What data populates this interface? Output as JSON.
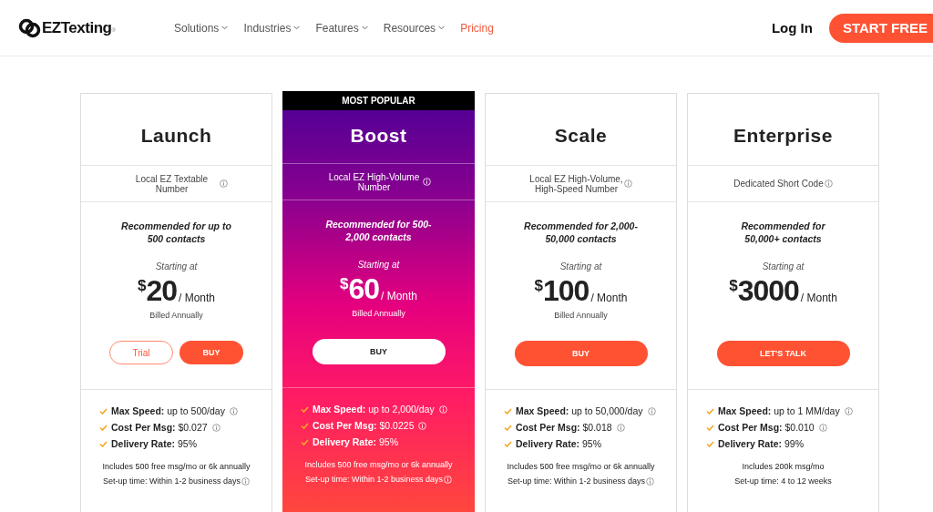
{
  "header": {
    "logo": "EZTexting",
    "logo_mark": "®",
    "nav": [
      {
        "label": "Solutions",
        "dropdown": true,
        "selected": false
      },
      {
        "label": "Industries",
        "dropdown": true,
        "selected": false
      },
      {
        "label": "Features",
        "dropdown": true,
        "selected": false
      },
      {
        "label": "Resources",
        "dropdown": true,
        "selected": false
      },
      {
        "label": "Pricing",
        "dropdown": false,
        "selected": true
      }
    ],
    "login": "Log In",
    "cta": "START FREE"
  },
  "plans": [
    {
      "name": "Launch",
      "featured": false,
      "number_type": "Local EZ Textable Number",
      "recommended": "Recommended for up to 500 contacts",
      "starting": "Starting at",
      "currency": "$",
      "amount": "20",
      "period": "/ Month",
      "billing": "Billed Annually",
      "buttons": [
        {
          "label": "Trial",
          "kind": "outline"
        },
        {
          "label": "BUY",
          "kind": "filled"
        }
      ],
      "features": [
        {
          "text": "**Max Speed:** up to 500/day",
          "info": true
        },
        {
          "text": "**Cost Per Msg:** $0.027",
          "info": true
        },
        {
          "text": "**Delivery Rate:** 95%",
          "info": false
        }
      ],
      "notes": [
        {
          "text": "Includes 500 free msg/mo or 6k annually",
          "info": false
        },
        {
          "text": "Set-up time: Within 1-2 business days",
          "info": true
        }
      ]
    },
    {
      "name": "Boost",
      "featured": true,
      "badge": "MOST POPULAR",
      "number_type": "Local EZ High-Volume Number",
      "recommended": "Recommended for 500-2,000 contacts",
      "starting": "Starting at",
      "currency": "$",
      "amount": "60",
      "period": "/ Month",
      "billing": "Billed Annually",
      "buttons": [
        {
          "label": "BUY",
          "kind": "white"
        }
      ],
      "features": [
        {
          "text": "**Max Speed:** up to 2,000/day",
          "info": true
        },
        {
          "text": "**Cost Per Msg:** $0.0225",
          "info": true
        },
        {
          "text": "**Delivery Rate:** 95%",
          "info": false
        }
      ],
      "notes": [
        {
          "text": "Includes 500 free msg/mo or 6k annually",
          "info": false
        },
        {
          "text": "Set-up time: Within 1-2 business days",
          "info": true
        }
      ]
    },
    {
      "name": "Scale",
      "featured": false,
      "number_type": "Local EZ High-Volume, High-Speed Number",
      "recommended": "Recommended for 2,000-50,000 contacts",
      "starting": "Starting at",
      "currency": "$",
      "amount": "100",
      "period": "/ Month",
      "billing": "Billed Annually",
      "buttons": [
        {
          "label": "BUY",
          "kind": "wide"
        }
      ],
      "features": [
        {
          "text": "**Max Speed:** up to 50,000/day",
          "info": true
        },
        {
          "text": "**Cost Per Msg:** $0.018",
          "info": true
        },
        {
          "text": "**Delivery Rate:** 95%",
          "info": false
        }
      ],
      "notes": [
        {
          "text": "Includes 500 free msg/mo or 6k annually",
          "info": false
        },
        {
          "text": "Set-up time: Within 1-2 business days",
          "info": true
        }
      ]
    },
    {
      "name": "Enterprise",
      "featured": false,
      "number_type": "Dedicated Short Code",
      "recommended": "Recommended for 50,000+ contacts",
      "starting": "Starting at",
      "currency": "$",
      "amount": "3000",
      "period": "/ Month",
      "buttons": [
        {
          "label": "LET'S TALK",
          "kind": "wide"
        }
      ],
      "features": [
        {
          "text": "**Max Speed:** up to 1 MM/day",
          "info": true
        },
        {
          "text": "**Cost Per Msg:** $0.010",
          "info": true
        },
        {
          "text": "**Delivery Rate:** 99%",
          "info": false
        }
      ],
      "notes": [
        {
          "text": "Includes 200k msg/mo",
          "info": false
        },
        {
          "text": "Set-up time: 4 to 12 weeks",
          "info": false
        }
      ]
    }
  ]
}
